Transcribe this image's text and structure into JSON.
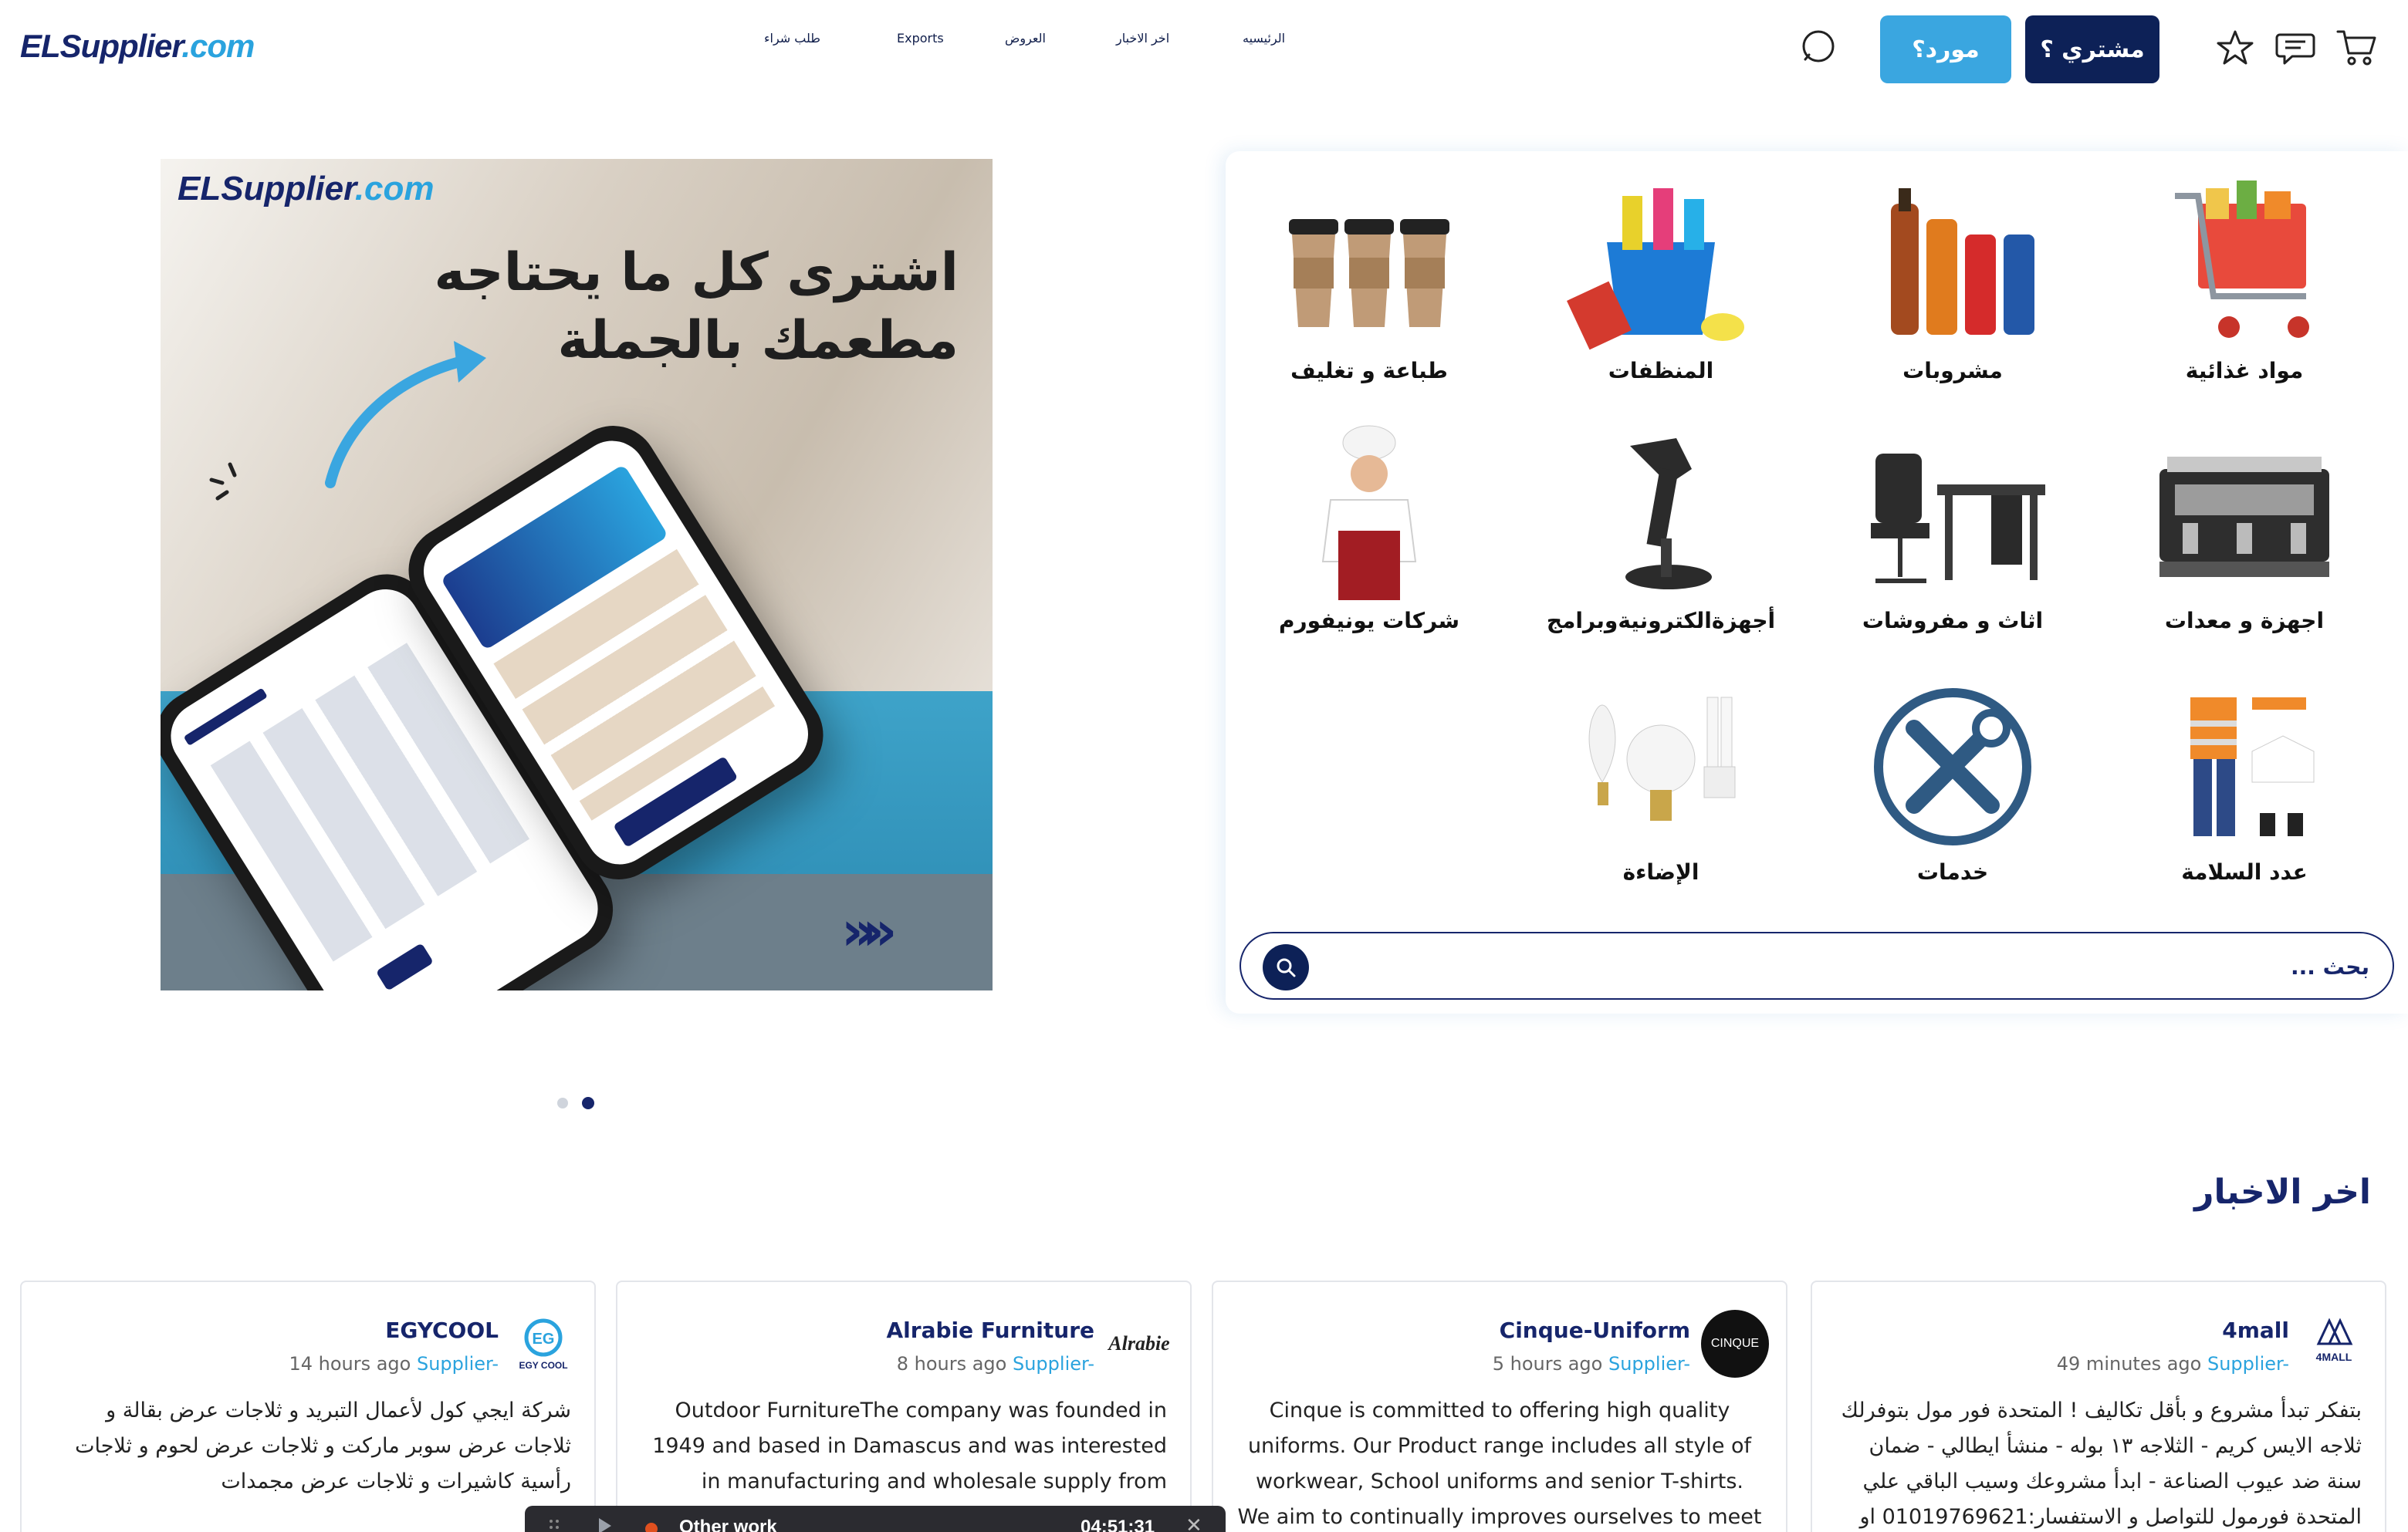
{
  "header": {
    "logo_part1": "ELSupplier",
    "logo_part2": ".com",
    "nav": {
      "home": "الرئيسيه",
      "news": "اخر الاخبار",
      "offers": "العروض",
      "exports": "Exports",
      "purchase_request": "طلب شراء"
    },
    "buyer_button": "مشتري ؟",
    "supplier_button": "مورد؟"
  },
  "banner": {
    "logo_part1": "ELSupplier",
    "logo_part2": ".com",
    "headline_line1": "اشترى كل ما يحتاجه",
    "headline_line2": "مطعمك بالجملة"
  },
  "carousel": {
    "slides": 2,
    "active": 2
  },
  "categories": [
    {
      "label": "مواد غذائية",
      "icon": "cart-icon"
    },
    {
      "label": "مشروبات",
      "icon": "drinks-icon"
    },
    {
      "label": "المنظفات",
      "icon": "cleaning-bucket-icon"
    },
    {
      "label": "طباعة و تغليف",
      "icon": "paper-cups-icon"
    },
    {
      "label": "اجهزة و معدات",
      "icon": "espresso-machine-icon"
    },
    {
      "label": "اثاث و مفروشات",
      "icon": "office-furniture-icon"
    },
    {
      "label": "أجهزةالكترونيةوبرامج",
      "icon": "barcode-scanner-icon"
    },
    {
      "label": "شركات يونيفورم",
      "icon": "chef-icon"
    },
    {
      "label": "عدد السلامة",
      "icon": "safety-gear-icon"
    },
    {
      "label": "خدمات",
      "icon": "tools-icon"
    },
    {
      "label": "الإضاءة",
      "icon": "light-bulbs-icon"
    }
  ],
  "search": {
    "placeholder": "بحث ..."
  },
  "news": {
    "title": "اخر الاخبار",
    "cards": [
      {
        "name": "4mall",
        "time": "49 minutes ago",
        "role": "Supplier-",
        "logo_text": "4MALL",
        "body": "بتفكر تبدأ مشروع و بأقل تكاليف ! المتحدة فور مول بتوفرلك ثلاجه الايس كريم - الثلاجه ١٣ بوله - منشأ ايطالي - ضمان سنة ضد عيوب الصناعة - ابدأ مشروعك وسيب الباقي علي المتحدة فورمول للتواصل و الاستفسار:01019769621 او"
      },
      {
        "name": "Cinque-Uniform",
        "time": "5 hours ago",
        "role": "Supplier-",
        "logo_text": "CINQUE",
        "body": "Cinque is committed to offering high quality uniforms. Our Product range includes all style of workwear, School uniforms and senior T-shirts. We aim to continually improves ourselves to meet the clients requirements"
      },
      {
        "name": "Alrabie Furniture",
        "time": "8 hours ago",
        "role": "Supplier-",
        "logo_text": "Alrabie",
        "body": "Outdoor FurnitureThe company was founded in 1949 and based in Damascus and was interested in manufacturing and wholesale supply from wooden and metal furniture"
      },
      {
        "name": "EGYCOOL",
        "time": "14 hours ago",
        "role": "Supplier-",
        "logo_text": "EGY COOL",
        "body": "شركة ايجي كول لأعمال التبريد و ثلاجات عرض بقالة و ثلاجات عرض سوبر ماركت و ثلاجات عرض لحوم و ثلاجات رأسية كاشيرات و ثلاجات عرض مجمدات"
      }
    ]
  },
  "player": {
    "title": "Other work",
    "time": "04:51:31"
  },
  "colors": {
    "navy": "#0d2157",
    "accent": "#2aa3de",
    "text": "#16256b"
  }
}
